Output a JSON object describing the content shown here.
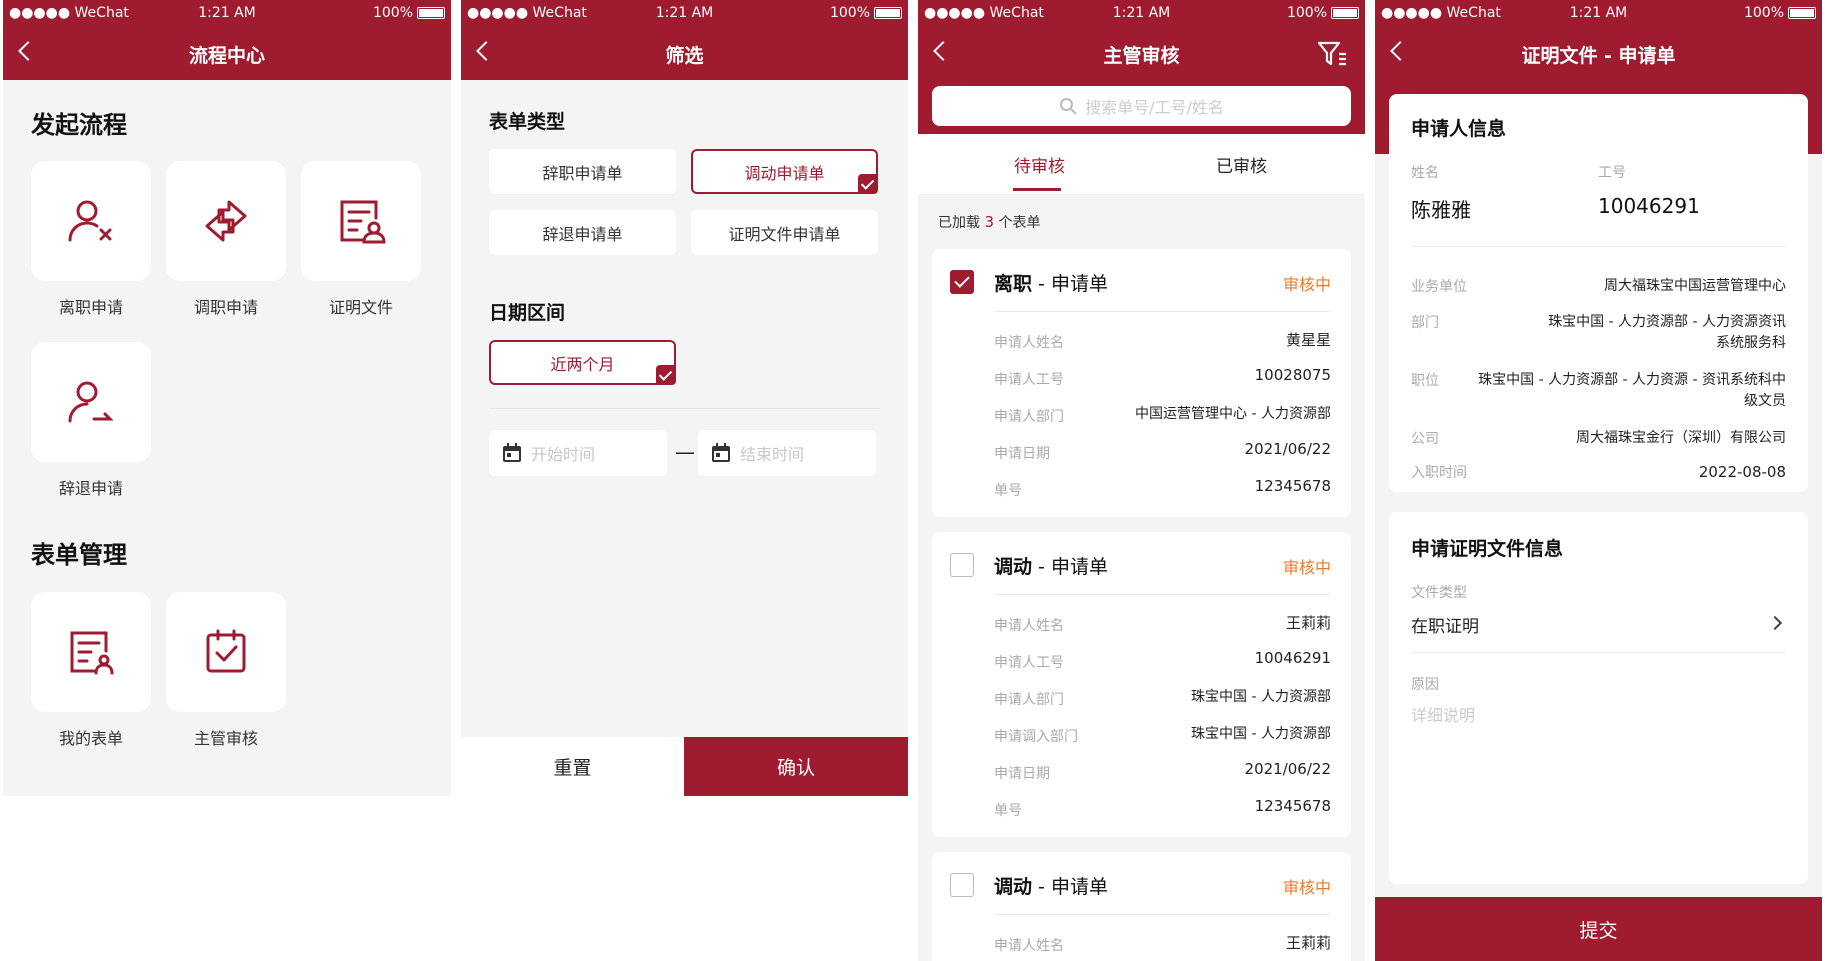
{
  "status_bar": {
    "carrier": "●●●●● WeChat",
    "time": "1:21 AM",
    "battery": "100%"
  },
  "colors": {
    "brand": "#9e1b30",
    "pending": "#f07a2b"
  },
  "screen1": {
    "title": "流程中心",
    "section_start": "发起流程",
    "start_items": [
      {
        "label": "离职申请",
        "icon": "user-x-icon"
      },
      {
        "label": "调职申请",
        "icon": "swap-arrows-icon"
      },
      {
        "label": "证明文件",
        "icon": "document-user-icon"
      },
      {
        "label": "辞退申请",
        "icon": "user-out-icon"
      }
    ],
    "section_manage": "表单管理",
    "manage_items": [
      {
        "label": "我的表单",
        "icon": "form-user-icon"
      },
      {
        "label": "主管审核",
        "icon": "clipboard-check-icon"
      }
    ]
  },
  "screen2": {
    "title": "筛选",
    "form_type_title": "表单类型",
    "form_types": [
      "辞职申请单",
      "调动申请单",
      "辞退申请单",
      "证明文件申请单"
    ],
    "selected_form_type": "调动申请单",
    "date_title": "日期区间",
    "date_option": "近两个月",
    "start_placeholder": "开始时间",
    "dash": "—",
    "end_placeholder": "结束时间",
    "reset": "重置",
    "confirm": "确认"
  },
  "screen3": {
    "title": "主管审核",
    "search_placeholder": "搜索单号/工号/姓名",
    "tabs": [
      "待审核",
      "已审核"
    ],
    "loaded_prefix": "已加载",
    "loaded_count": "3",
    "loaded_suffix": "个表单",
    "cards": [
      {
        "type": "离职",
        "suffix": " - 申请单",
        "status": "审核中",
        "checked": true,
        "rows": [
          [
            "申请人姓名",
            "黄星星"
          ],
          [
            "申请人工号",
            "10028075"
          ],
          [
            "申请人部门",
            "中国运营管理中心 - 人力资源部"
          ],
          [
            "申请日期",
            "2021/06/22"
          ],
          [
            "单号",
            "12345678"
          ]
        ]
      },
      {
        "type": "调动",
        "suffix": " - 申请单",
        "status": "审核中",
        "checked": false,
        "rows": [
          [
            "申请人姓名",
            "王莉莉"
          ],
          [
            "申请人工号",
            "10046291"
          ],
          [
            "申请人部门",
            "珠宝中国 - 人力资源部"
          ],
          [
            "申请调入部门",
            "珠宝中国 - 人力资源部"
          ],
          [
            "申请日期",
            "2021/06/22"
          ],
          [
            "单号",
            "12345678"
          ]
        ]
      },
      {
        "type": "调动",
        "suffix": " - 申请单",
        "status": "审核中",
        "checked": false,
        "rows": [
          [
            "申请人姓名",
            "王莉莉"
          ]
        ]
      }
    ]
  },
  "screen4": {
    "title": "证明文件 - 申请单",
    "applicant_title": "申请人信息",
    "name_label": "姓名",
    "id_label": "工号",
    "name": "陈雅雅",
    "emp_id": "10046291",
    "info": [
      {
        "k": "业务单位",
        "v": "周大福珠宝中国运营管理中心"
      },
      {
        "k": "部门",
        "v": "珠宝中国 - 人力资源部 - 人力资源资讯系统服务科"
      },
      {
        "k": "职位",
        "v": "珠宝中国 - 人力资源部 - 人力资源 - 资讯系统科中级文员"
      },
      {
        "k": "公司",
        "v": "周大福珠宝金行（深圳）有限公司"
      },
      {
        "k": "入职时间",
        "v": "2022-08-08"
      }
    ],
    "doc_title": "申请证明文件信息",
    "doc_type_label": "文件类型",
    "doc_type": "在职证明",
    "reason_label": "原因",
    "reason_placeholder": "详细说明",
    "submit": "提交"
  }
}
